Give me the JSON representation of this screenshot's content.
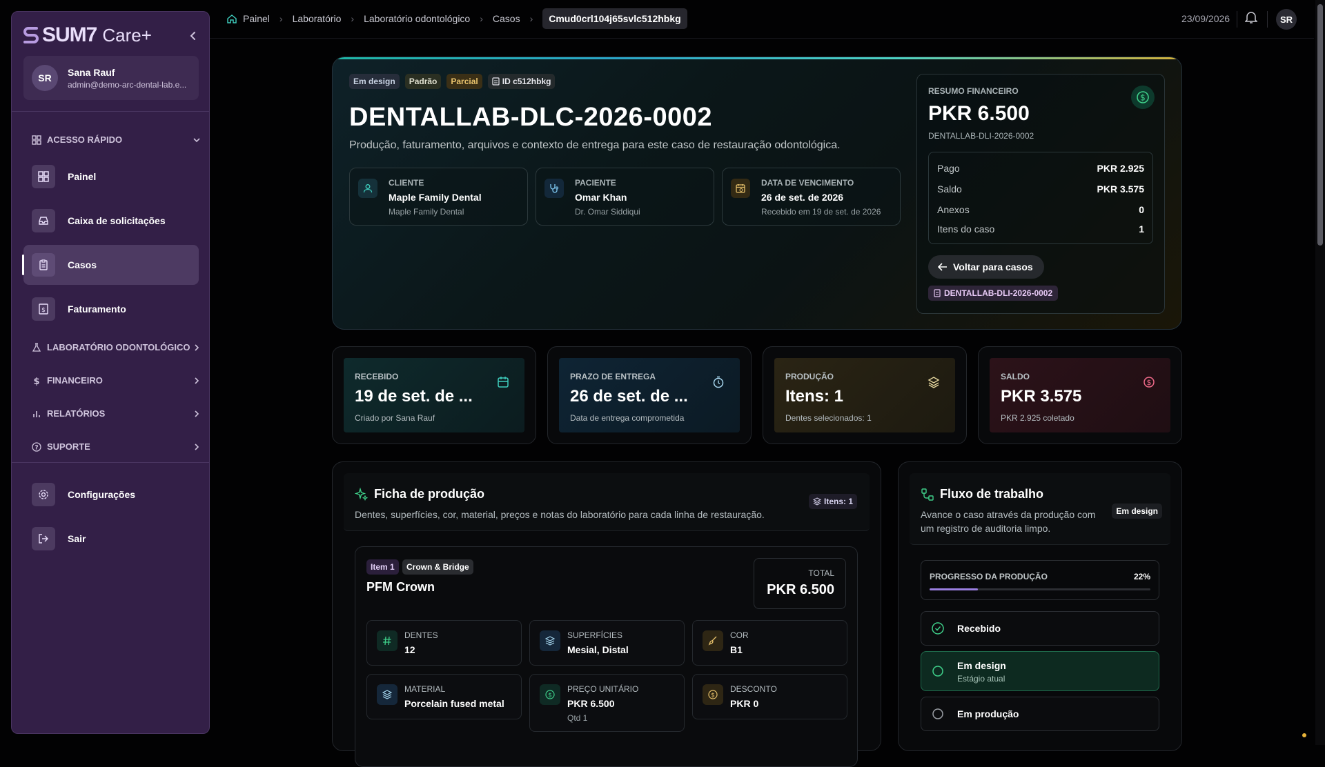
{
  "sidebar": {
    "brand": {
      "logo": "SUM7",
      "product": "Care+"
    },
    "user": {
      "initials": "SR",
      "name": "Sana Rauf",
      "email": "admin@demo-arc-dental-lab.e..."
    },
    "quick_access": "ACESSO RÁPIDO",
    "items": [
      {
        "label": "Painel"
      },
      {
        "label": "Caixa de solicitações"
      },
      {
        "label": "Casos"
      },
      {
        "label": "Faturamento"
      }
    ],
    "sections": [
      {
        "label": "LABORATÓRIO ODONTOLÓGICO"
      },
      {
        "label": "FINANCEIRO"
      },
      {
        "label": "RELATÓRIOS"
      },
      {
        "label": "SUPORTE"
      }
    ],
    "bottom": [
      {
        "label": "Configurações"
      },
      {
        "label": "Sair"
      }
    ]
  },
  "breadcrumb": [
    "Painel",
    "Laboratório",
    "Laboratório odontológico",
    "Casos",
    "Cmud0crl104j65svlc512hbkg"
  ],
  "topbar": {
    "date": "23/09/2026",
    "avatar": "SR"
  },
  "hero": {
    "tags": [
      "Em design",
      "Padrão",
      "Parcial",
      "ID c512hbkg"
    ],
    "title": "DENTALLAB-DLC-2026-0002",
    "description": "Produção, faturamento, arquivos e contexto de entrega para este caso de restauração odontológica.",
    "cards": [
      {
        "label": "CLIENTE",
        "value": "Maple Family Dental",
        "sub": "Maple Family Dental",
        "icon": "user-icon"
      },
      {
        "label": "PACIENTE",
        "value": "Omar Khan",
        "sub": "Dr. Omar Siddiqui",
        "icon": "stethoscope-icon"
      },
      {
        "label": "DATA DE VENCIMENTO",
        "value": "26 de set. de 2026",
        "sub": "Recebido em 19 de set. de 2026",
        "icon": "calendar-clock-icon"
      }
    ]
  },
  "finance": {
    "label": "RESUMO FINANCEIRO",
    "amount": "PKR 6.500",
    "ref": "DENTALLAB-DLI-2026-0002",
    "rows": [
      {
        "k": "Pago",
        "v": "PKR 2.925"
      },
      {
        "k": "Saldo",
        "v": "PKR 3.575"
      },
      {
        "k": "Anexos",
        "v": "0"
      },
      {
        "k": "Itens do caso",
        "v": "1"
      }
    ],
    "back_button": "Voltar para casos",
    "invoice_chip": "DENTALLAB-DLI-2026-0002"
  },
  "stats": [
    {
      "label": "RECEBIDO",
      "value": "19 de set. de ...",
      "sub": "Criado por Sana Rauf",
      "icon": "calendar-icon",
      "color": "#3fd0c0"
    },
    {
      "label": "PRAZO DE ENTREGA",
      "value": "26 de set. de ...",
      "sub": "Data de entrega comprometida",
      "icon": "timer-icon",
      "color": "#7ec8f0"
    },
    {
      "label": "PRODUÇÃO",
      "value": "Itens: 1",
      "sub": "Dentes selecionados: 1",
      "icon": "layers-icon",
      "color": "#e8c26c"
    },
    {
      "label": "SALDO",
      "value": "PKR 3.575",
      "sub": "PKR 2.925 coletado",
      "icon": "dollar-circle-icon",
      "color": "#f06a8a"
    }
  ],
  "production": {
    "title": "Ficha de produção",
    "subtitle": "Dentes, superfícies, cor, material, preços e notas do laboratório para cada linha de restauração.",
    "badge": "Itens: 1",
    "item": {
      "chips": [
        "Item 1",
        "Crown & Bridge"
      ],
      "name": "PFM Crown",
      "total_label": "TOTAL",
      "total_value": "PKR 6.500",
      "attrs": [
        {
          "label": "DENTES",
          "value": "12",
          "sub": "",
          "icon": "hash-icon"
        },
        {
          "label": "SUPERFÍCIES",
          "value": "Mesial, Distal",
          "sub": "",
          "icon": "layers-icon"
        },
        {
          "label": "COR",
          "value": "B1",
          "sub": "",
          "icon": "brush-icon"
        },
        {
          "label": "MATERIAL",
          "value": "Porcelain fused metal",
          "sub": "",
          "icon": "layers-icon"
        },
        {
          "label": "PREÇO UNITÁRIO",
          "value": "PKR 6.500",
          "sub": "Qtd 1",
          "icon": "dollar-circle-icon"
        },
        {
          "label": "DESCONTO",
          "value": "PKR 0",
          "sub": "",
          "icon": "dollar-circle-icon"
        }
      ]
    }
  },
  "workflow": {
    "title": "Fluxo de trabalho",
    "subtitle_line1": "Avance o caso através da produção com",
    "subtitle_line2": "um registro de auditoria limpo.",
    "badge": "Em design",
    "progress_label": "PROGRESSO DA PRODUÇÃO",
    "progress_text": "22%",
    "progress_value": 0.22,
    "stages": [
      {
        "label": "Recebido",
        "sub": "",
        "state": "done"
      },
      {
        "label": "Em design",
        "sub": "Estágio atual",
        "state": "current"
      },
      {
        "label": "Em produção",
        "sub": "",
        "state": "pending"
      }
    ]
  }
}
